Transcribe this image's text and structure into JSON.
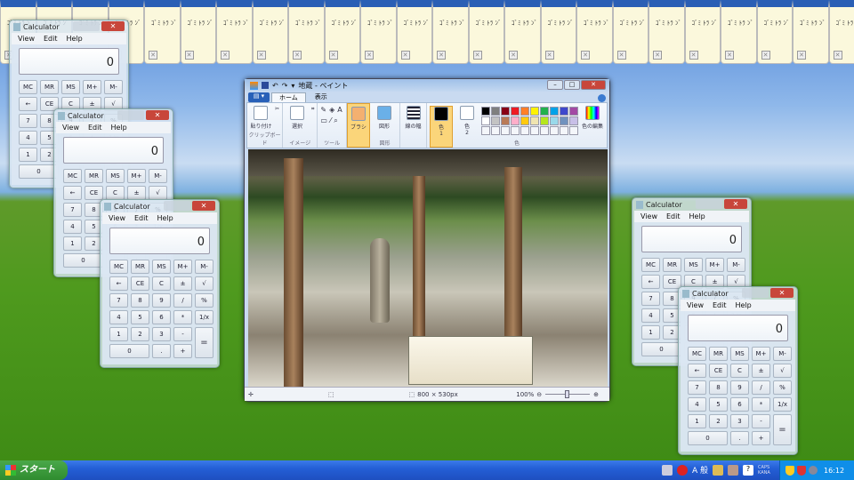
{
  "tabstrip": {
    "card_text": "ｺﾞﾐ ﾄﾗ ﾝﾞ",
    "card_count": 24,
    "close_glyph": "✕"
  },
  "calculator": {
    "title": "Calculator",
    "close_glyph": "✕",
    "menu": [
      "View",
      "Edit",
      "Help"
    ],
    "display": "0",
    "buttons": [
      "MC",
      "MR",
      "MS",
      "M+",
      "M-",
      "←",
      "CE",
      "C",
      "±",
      "√",
      "7",
      "8",
      "9",
      "/",
      "%",
      "4",
      "5",
      "6",
      "*",
      "1/x",
      "1",
      "2",
      "3",
      "-",
      "=",
      "0",
      ".",
      "+"
    ],
    "windows": 5
  },
  "paint": {
    "title": "地蔵 - ペイント",
    "file_menu": "▤ ▾",
    "tabs": [
      "ホーム",
      "表示"
    ],
    "groups": {
      "clipboard": "クリップボード",
      "image": "イメージ",
      "tools": "ツール",
      "shapes": "図形",
      "colors": "色"
    },
    "buttons": {
      "paste": "貼り付け",
      "select": "選択",
      "brush": "ブラシ",
      "shapes": "図形",
      "size": "線の幅",
      "color1": "色\n1",
      "color2": "色\n2",
      "edit_colors": "色の編集"
    },
    "palette": [
      "#000000",
      "#7f7f7f",
      "#880015",
      "#ed1c24",
      "#ff7f27",
      "#fff200",
      "#22b14c",
      "#00a2e8",
      "#3f48cc",
      "#a349a4",
      "#ffffff",
      "#c3c3c3",
      "#b97a57",
      "#ffaec9",
      "#ffc90e",
      "#efe4b0",
      "#b5e61d",
      "#99d9ea",
      "#7092be",
      "#c8bfe7"
    ],
    "color1": "#000000",
    "color2": "#ffffff",
    "status": {
      "image_size": "800 × 530px",
      "zoom": "100%",
      "zoom_fraction": 0.5
    }
  },
  "taskbar": {
    "start_label": "スタート",
    "ime_mode": "A 般",
    "caps": "CAPS",
    "kana": "KANA",
    "clock": "16:12"
  }
}
